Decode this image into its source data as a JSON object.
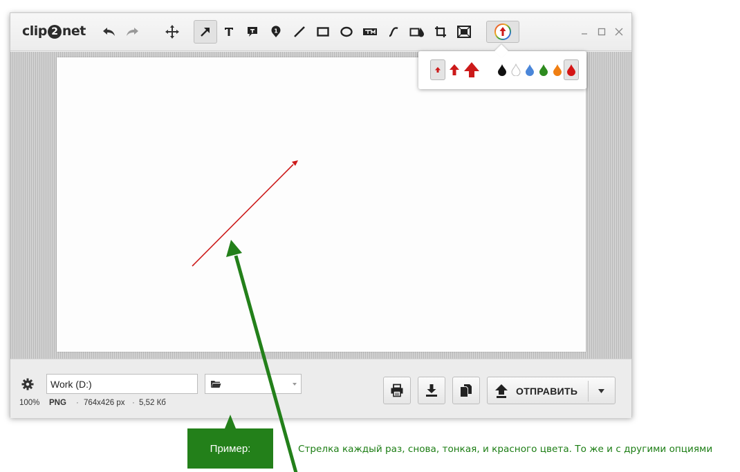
{
  "app": {
    "logo_left": "clip",
    "logo_mid": "2",
    "logo_right": "net"
  },
  "toolbar": {
    "tools": [
      {
        "name": "undo-icon"
      },
      {
        "name": "redo-icon"
      },
      {
        "name": "move-icon"
      },
      {
        "name": "arrow-tool-icon",
        "active": true
      },
      {
        "name": "text-icon"
      },
      {
        "name": "callout-icon"
      },
      {
        "name": "number-marker-icon"
      },
      {
        "name": "line-icon"
      },
      {
        "name": "rectangle-icon"
      },
      {
        "name": "ellipse-icon"
      },
      {
        "name": "watermark-icon"
      },
      {
        "name": "freehand-icon"
      },
      {
        "name": "blur-icon"
      },
      {
        "name": "crop-icon"
      },
      {
        "name": "resize-icon"
      },
      {
        "name": "arrow-style-icon"
      }
    ]
  },
  "popup": {
    "sizes": [
      "small",
      "medium",
      "large"
    ],
    "selected_size": "small",
    "colors": [
      "#111111",
      "#ffffff",
      "#4a86d9",
      "#2e8b1f",
      "#f07f12",
      "#d41414"
    ],
    "selected_color": "#d41414"
  },
  "bottom": {
    "path_value": "Work (D:)",
    "zoom": "100%",
    "format": "PNG",
    "dimensions": "764x426 px",
    "file_size": "5,52 Кб",
    "send_label": "ОТПРАВИТЬ"
  },
  "annotation": {
    "example_label": "Пример:",
    "note_text": "Стрелка каждый раз, снова, тонкая, и красного цвета. То же и с другими опциями"
  },
  "colors": {
    "accent_green": "#23801a",
    "arrow_red": "#cc1a1a"
  }
}
